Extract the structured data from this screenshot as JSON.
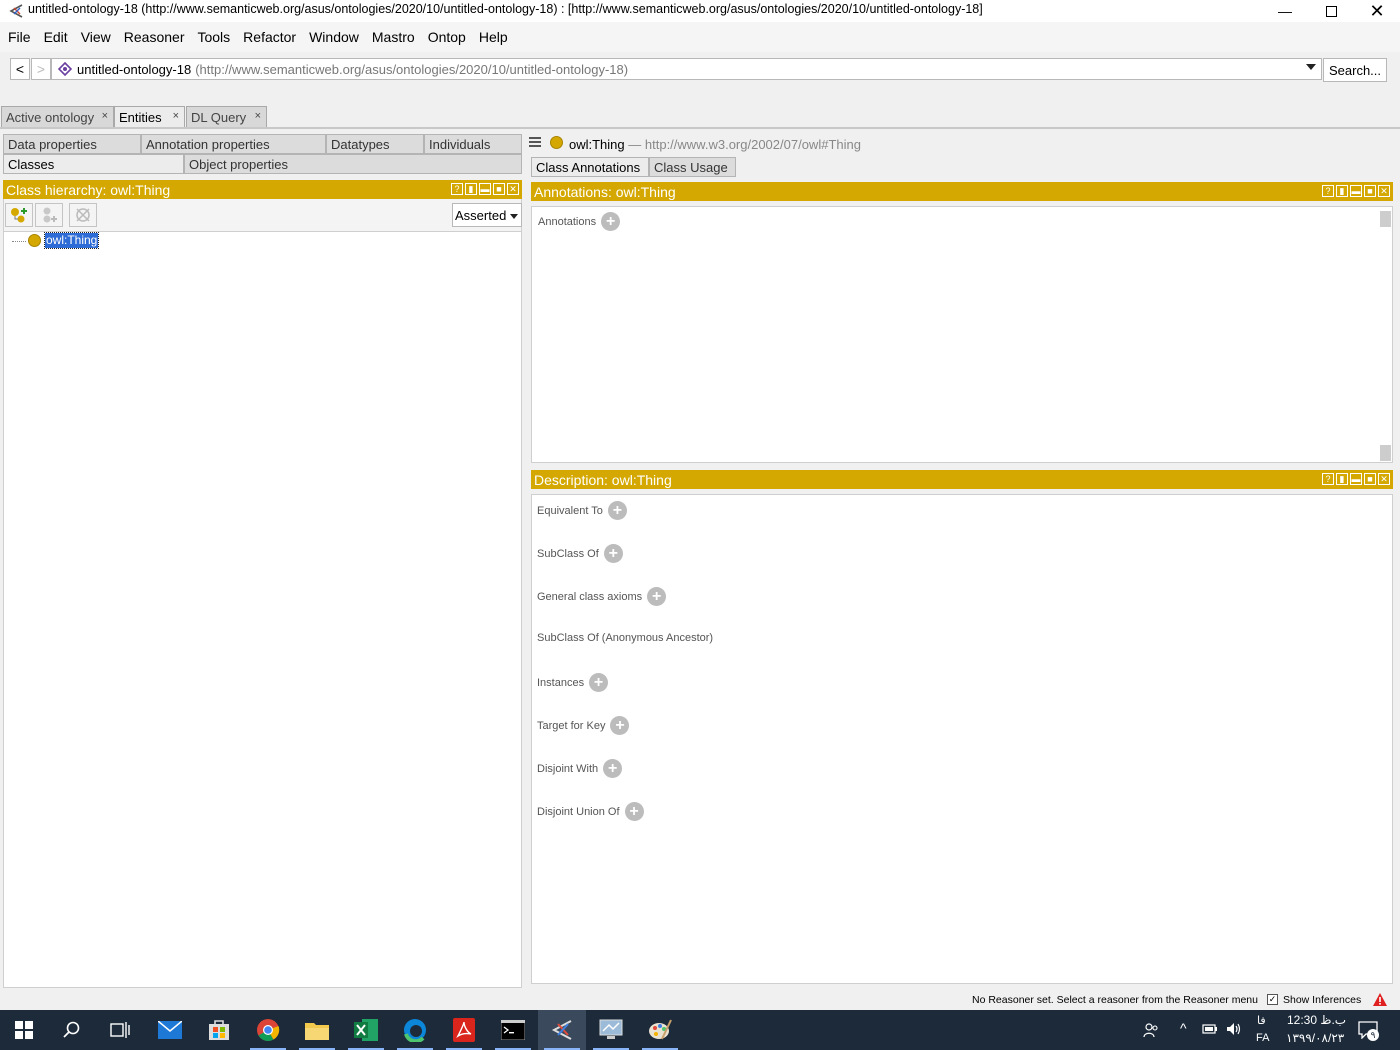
{
  "window": {
    "title": "untitled-ontology-18 (http://www.semanticweb.org/asus/ontologies/2020/10/untitled-ontology-18)  : [http://www.semanticweb.org/asus/ontologies/2020/10/untitled-ontology-18]"
  },
  "menu": [
    "File",
    "Edit",
    "View",
    "Reasoner",
    "Tools",
    "Refactor",
    "Window",
    "Mastro",
    "Ontop",
    "Help"
  ],
  "address": {
    "back": "<",
    "forward": ">",
    "name": "untitled-ontology-18",
    "uri": "(http://www.semanticweb.org/asus/ontologies/2020/10/untitled-ontology-18)",
    "search_label": "Search..."
  },
  "tabs": [
    {
      "label": "Active ontology",
      "close": "×"
    },
    {
      "label": "Entities",
      "close": "×"
    },
    {
      "label": "DL Query",
      "close": "×"
    }
  ],
  "entity_tabs": {
    "row1": [
      "Data properties",
      "Annotation properties",
      "Datatypes",
      "Individuals"
    ],
    "row2": [
      "Classes",
      "Object properties"
    ]
  },
  "class_hierarchy": {
    "header": "Class hierarchy: owl:Thing",
    "mode": "Asserted",
    "root": "owl:Thing"
  },
  "entity": {
    "name": "owl:Thing",
    "separator": "—",
    "iri": "http://www.w3.org/2002/07/owl#Thing"
  },
  "right_tabs": [
    "Class Annotations",
    "Class Usage"
  ],
  "annotations": {
    "header": "Annotations: owl:Thing",
    "label": "Annotations"
  },
  "description": {
    "header": "Description: owl:Thing",
    "rows": [
      {
        "label": "Equivalent To"
      },
      {
        "label": "SubClass Of"
      },
      {
        "label": "General class axioms"
      },
      {
        "label": "SubClass Of (Anonymous Ancestor)"
      },
      {
        "label": "Instances"
      },
      {
        "label": "Target for Key"
      },
      {
        "label": "Disjoint With"
      },
      {
        "label": "Disjoint Union Of"
      }
    ]
  },
  "status": {
    "message": "No Reasoner set. Select a reasoner from the Reasoner menu",
    "show_inferences": "Show Inferences"
  },
  "taskbar": {
    "time": "12:30 ب.ظ",
    "date": "۱۳۹۹/۰۸/۲۳",
    "lang_top": "فا",
    "lang": "FA",
    "notif_count": "۹"
  },
  "colors": {
    "view_header": "#d4a800",
    "selection": "#2d6bd6",
    "taskbar": "#1c2a3a"
  }
}
